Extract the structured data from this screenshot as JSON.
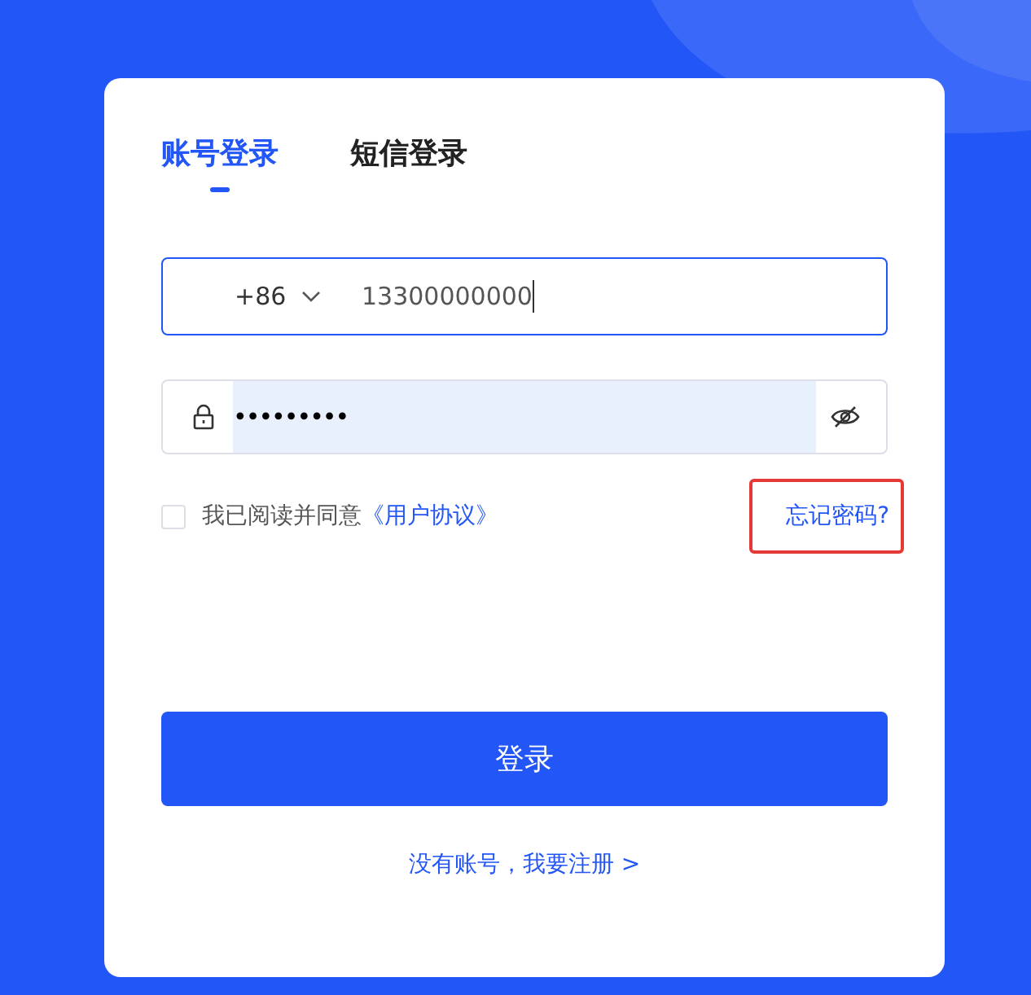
{
  "tabs": [
    {
      "label": "账号登录",
      "selected": true
    },
    {
      "label": "短信登录",
      "selected": false
    }
  ],
  "phone": {
    "country_code": "+86",
    "value": "13300000000",
    "focused": true
  },
  "password": {
    "value": "•••••••••",
    "autofilled": true
  },
  "agreement": {
    "checked": false,
    "text": "我已阅读并同意",
    "link": "《用户协议》"
  },
  "forgot_password": {
    "label": "忘记密码?",
    "highlighted": true
  },
  "login_button": "登录",
  "register_link": "没有账号，我要注册 >"
}
